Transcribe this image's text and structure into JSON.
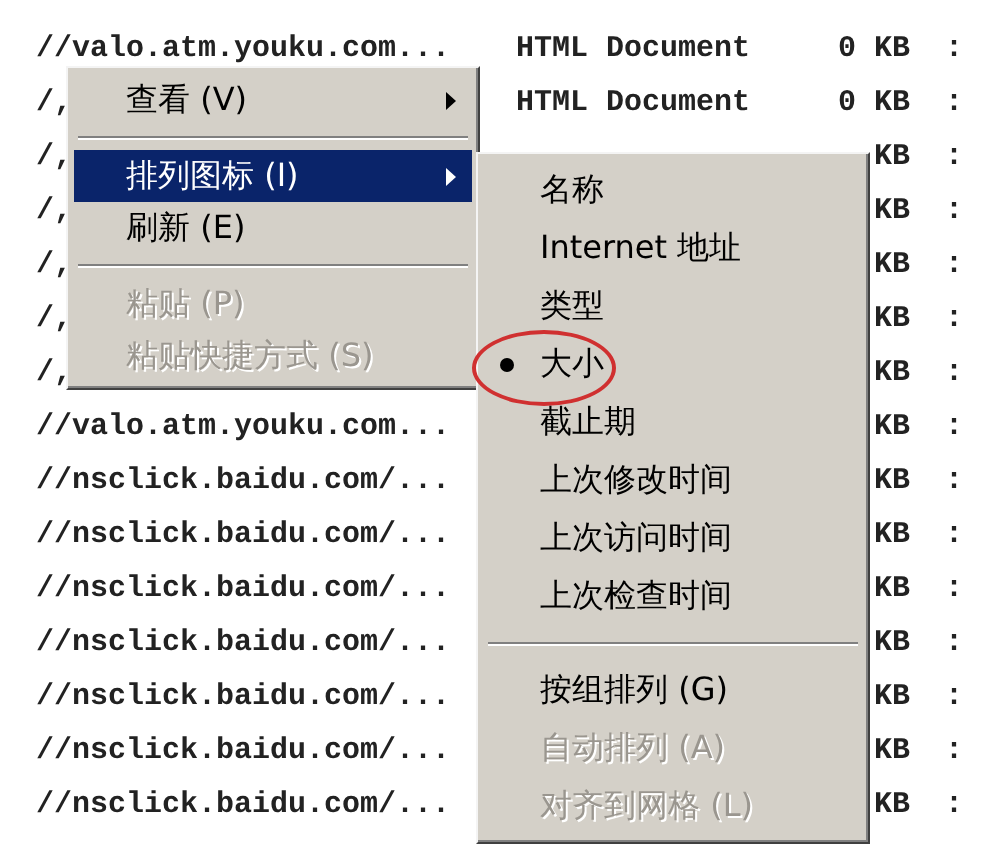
{
  "file_list": {
    "rows": [
      {
        "name": "//valo.atm.youku.com...",
        "type": "HTML Document",
        "size": "0 KB",
        "column_4": ":"
      },
      {
        "name": "/,",
        "type": "HTML Document",
        "size": "0 KB",
        "column_4": ":"
      },
      {
        "name": "/,",
        "size": "KB",
        "column_4": ":"
      },
      {
        "name": "/,",
        "size": "KB",
        "column_4": ":"
      },
      {
        "name": "/,",
        "size": "KB",
        "column_4": ":"
      },
      {
        "name": "/,",
        "size": "KB",
        "column_4": ":"
      },
      {
        "name": "/,",
        "size": "KB",
        "column_4": ":"
      },
      {
        "name": "//valo.atm.youku.com...",
        "size": "KB",
        "column_4": ":"
      },
      {
        "name": "//nsclick.baidu.com/...",
        "size": "KB",
        "column_4": ":"
      },
      {
        "name": "//nsclick.baidu.com/...",
        "size": "KB",
        "column_4": ":"
      },
      {
        "name": "//nsclick.baidu.com/...",
        "size": "KB",
        "column_4": ":"
      },
      {
        "name": "//nsclick.baidu.com/...",
        "size": "KB",
        "column_4": ":"
      },
      {
        "name": "//nsclick.baidu.com/...",
        "size": "KB",
        "column_4": ":"
      },
      {
        "name": "//nsclick.baidu.com/...",
        "size": "KB",
        "column_4": ":"
      },
      {
        "name": "//nsclick.baidu.com/...",
        "size": "KB",
        "column_4": ":"
      }
    ]
  },
  "context_menu": {
    "items": [
      {
        "kind": "item",
        "label": "查看 (V)",
        "submenu": true,
        "selected": false,
        "disabled": false
      },
      {
        "kind": "separator"
      },
      {
        "kind": "item",
        "label": "排列图标 (I)",
        "submenu": true,
        "selected": true,
        "disabled": false
      },
      {
        "kind": "item",
        "label": "刷新 (E)",
        "submenu": false,
        "selected": false,
        "disabled": false
      },
      {
        "kind": "separator"
      },
      {
        "kind": "item",
        "label": "粘贴 (P)",
        "submenu": false,
        "selected": false,
        "disabled": true
      },
      {
        "kind": "item",
        "label": "粘贴快捷方式 (S)",
        "submenu": false,
        "selected": false,
        "disabled": true
      }
    ]
  },
  "submenu": {
    "items": [
      {
        "kind": "item",
        "label": "名称",
        "checked": false,
        "disabled": false,
        "circled": false
      },
      {
        "kind": "item",
        "label": "Internet 地址",
        "checked": false,
        "disabled": false,
        "circled": false
      },
      {
        "kind": "item",
        "label": "类型",
        "checked": false,
        "disabled": false,
        "circled": false
      },
      {
        "kind": "item",
        "label": "大小",
        "checked": true,
        "disabled": false,
        "circled": true
      },
      {
        "kind": "item",
        "label": "截止期",
        "checked": false,
        "disabled": false,
        "circled": false
      },
      {
        "kind": "item",
        "label": "上次修改时间",
        "checked": false,
        "disabled": false,
        "circled": false
      },
      {
        "kind": "item",
        "label": "上次访问时间",
        "checked": false,
        "disabled": false,
        "circled": false
      },
      {
        "kind": "item",
        "label": "上次检查时间",
        "checked": false,
        "disabled": false,
        "circled": false
      },
      {
        "kind": "separator"
      },
      {
        "kind": "item",
        "label": "按组排列 (G)",
        "checked": false,
        "disabled": false,
        "circled": false
      },
      {
        "kind": "item",
        "label": "自动排列 (A)",
        "checked": false,
        "disabled": true,
        "circled": false
      },
      {
        "kind": "item",
        "label": "对齐到网格 (L)",
        "checked": false,
        "disabled": true,
        "circled": false
      }
    ]
  }
}
